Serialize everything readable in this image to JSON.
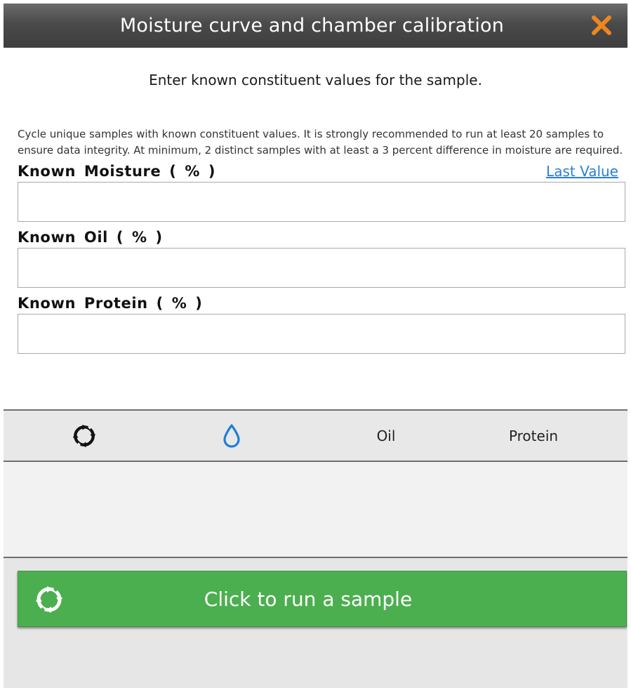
{
  "dialog": {
    "title": "Moisture curve and chamber calibration",
    "close_icon": "close-icon",
    "accent_color": "#f0861e"
  },
  "subtitle": "Enter known constituent values for the sample.",
  "instructions": "Cycle unique samples with known constituent values. It is strongly recommended to run at least 20 samples to ensure data integrity. At minimum, 2 distinct samples with at least a 3 percent difference in moisture are required.",
  "fields": {
    "moisture": {
      "label": "Known  Moisture  ( % )",
      "value": "",
      "link": "Last Value"
    },
    "oil": {
      "label": "Known  Oil  ( % )",
      "value": ""
    },
    "protein": {
      "label": "Known  Protein  ( % )",
      "value": ""
    }
  },
  "tabs": {
    "cycle_icon": "cycle-icon",
    "moisture_icon": "water-drop-icon",
    "oil": "Oil",
    "protein": "Protein",
    "moisture_color": "#1f7fd6"
  },
  "run_button": {
    "label": "Click to run a sample",
    "icon": "cycle-icon",
    "color": "#4caf4f"
  }
}
